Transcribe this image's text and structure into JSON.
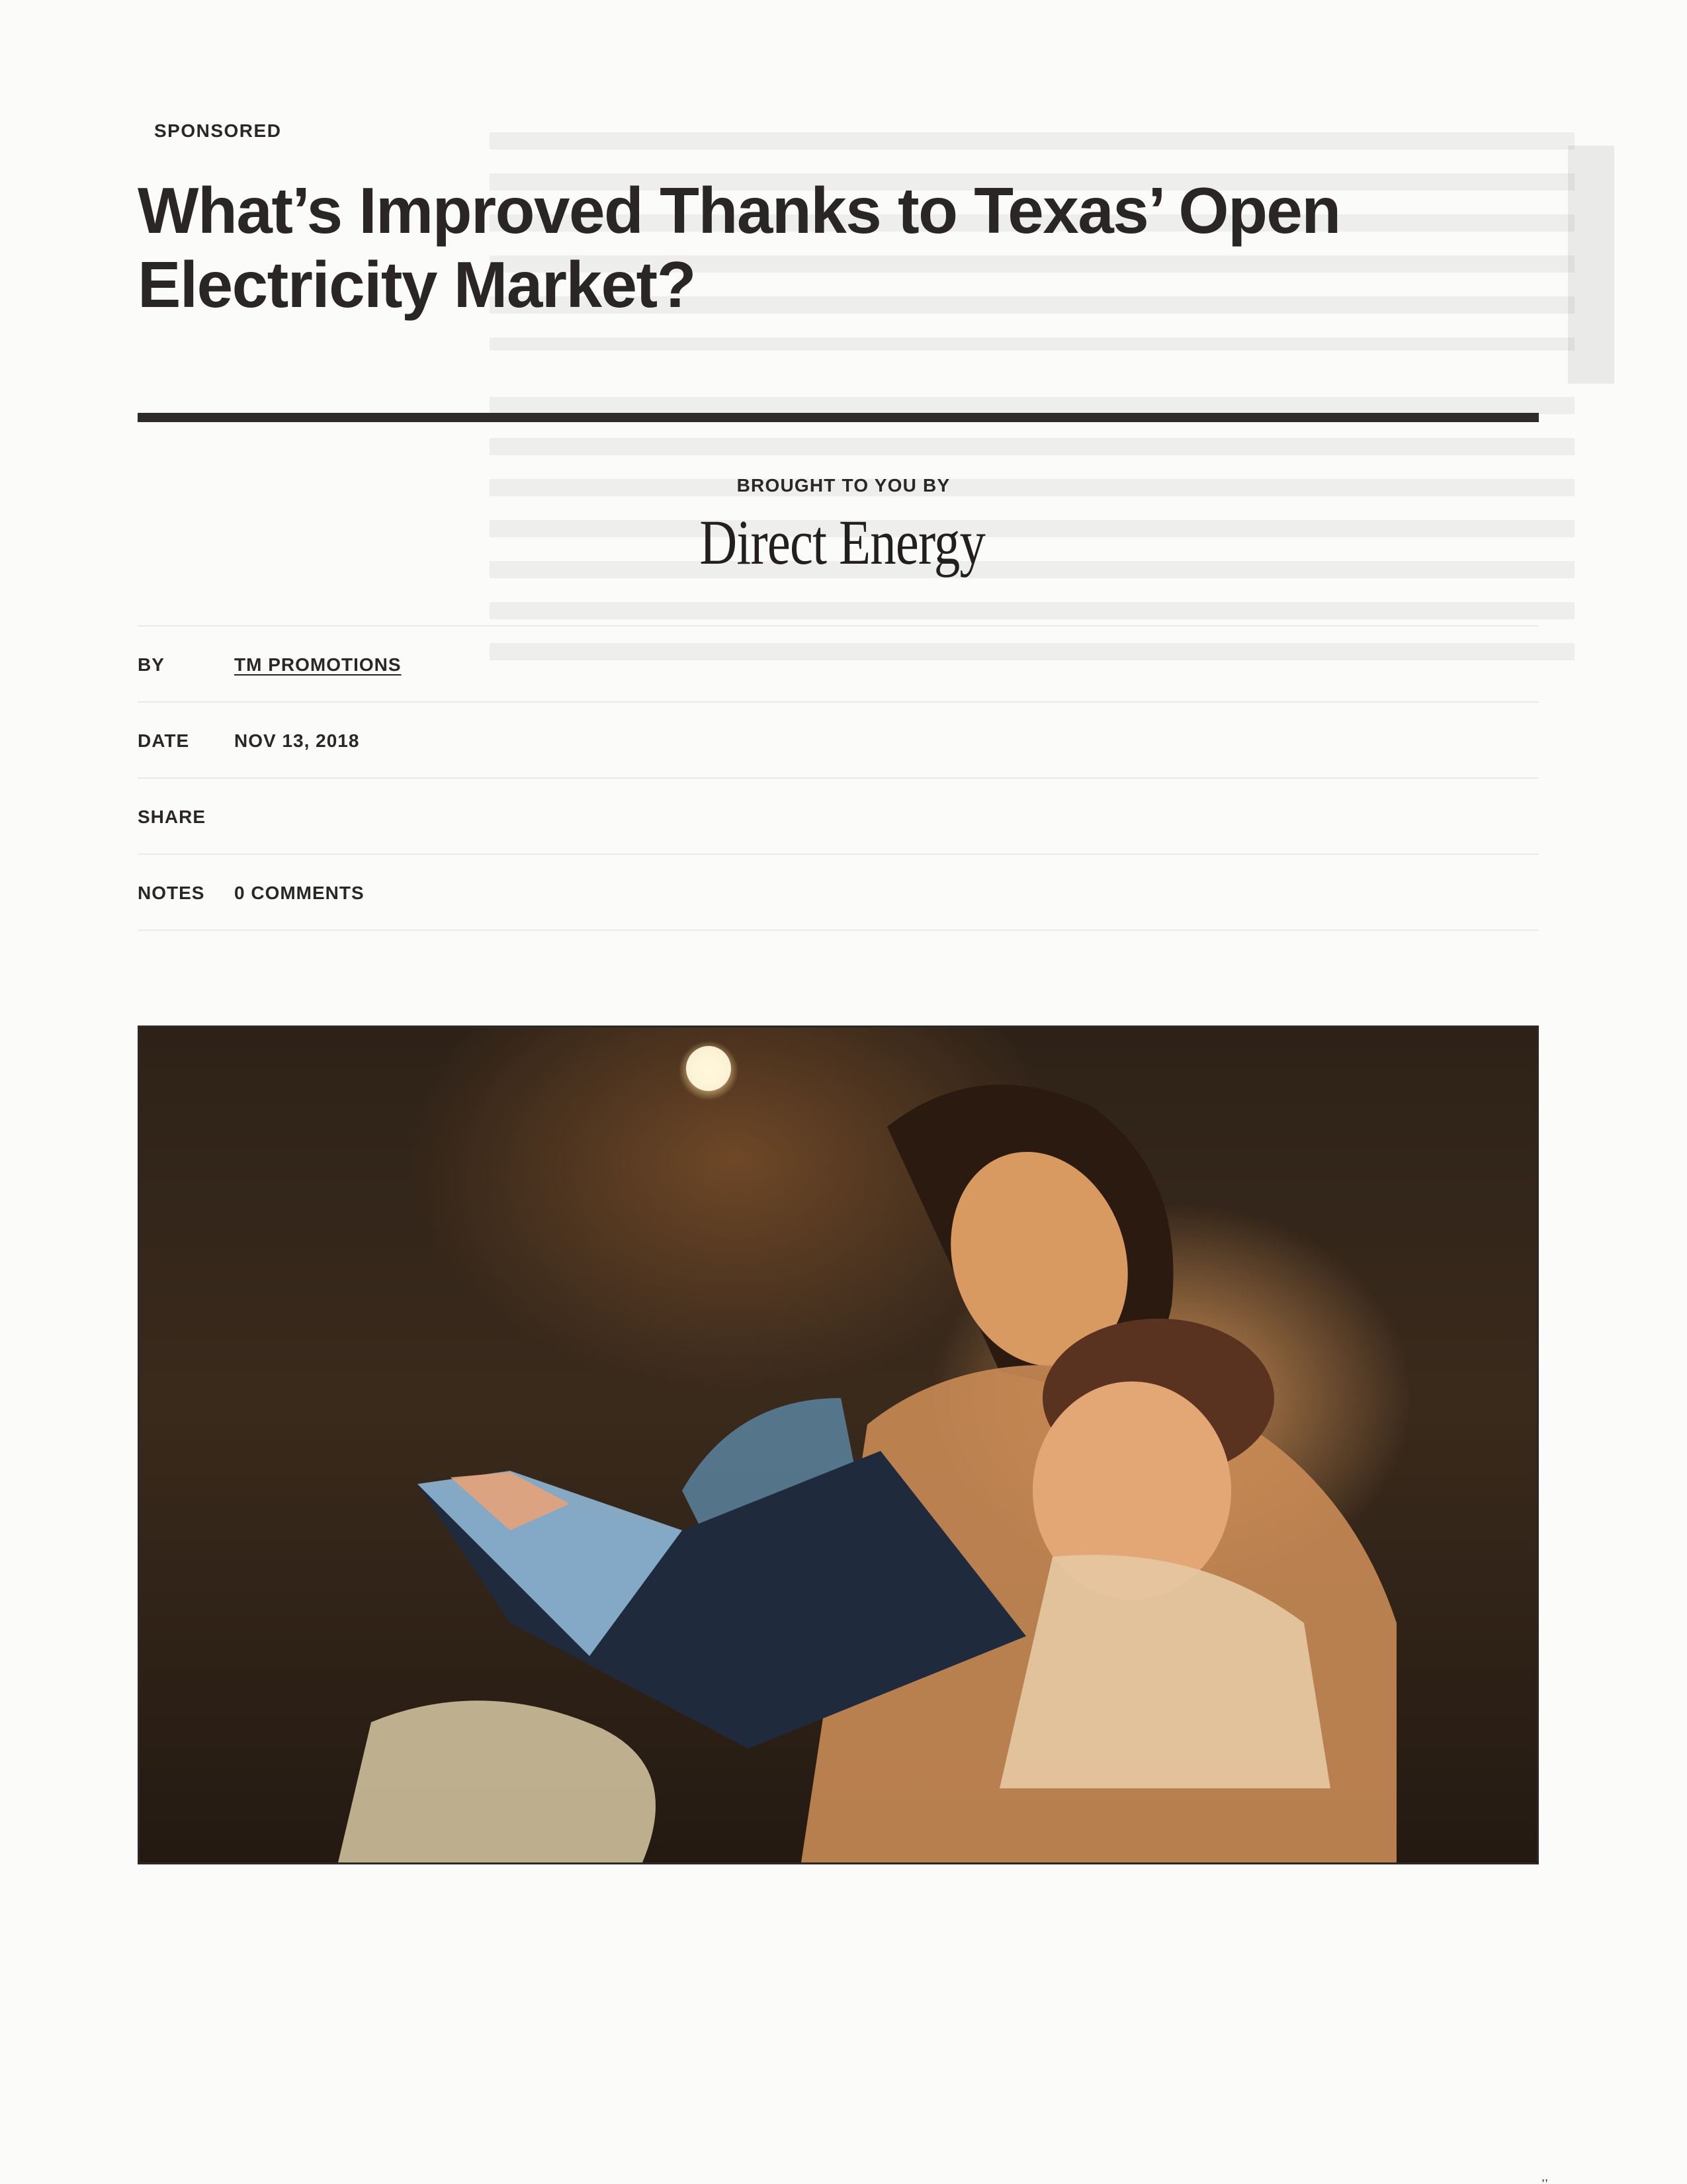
{
  "article": {
    "label": "SPONSORED",
    "title": "What’s Improved Thanks to Texas’ Open Electricity Market?",
    "sponsor_intro": "BROUGHT TO YOU BY",
    "sponsor_name": "Direct Energy"
  },
  "meta": {
    "by_label": "BY",
    "by_value": "TM PROMOTIONS",
    "date_label": "DATE",
    "date_value": "NOV 13, 2018",
    "share_label": "SHARE",
    "notes_label": "NOTES",
    "notes_value": "0 COMMENTS"
  },
  "colors": {
    "text": "#2a2625",
    "rule": "#2f2b2a",
    "divider": "#ebeae6",
    "background": "#fbfbfa"
  },
  "hero_image": {
    "description_icon": "photo-mother-daughter-reading-book"
  }
}
